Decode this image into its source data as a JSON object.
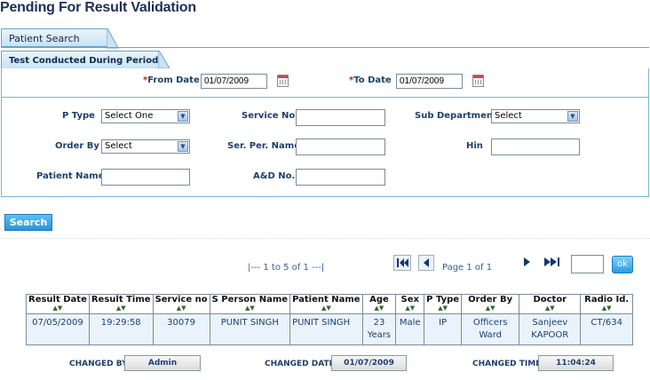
{
  "page": {
    "title": "Pending For Result Validation"
  },
  "tabs": {
    "patient_search": "Patient Search",
    "period": "Test Conducted During Period"
  },
  "period": {
    "from_label": "From Date",
    "from_value": "01/07/2009",
    "to_label": "To Date",
    "to_value": "01/07/2009",
    "required_mark": "*"
  },
  "filters": {
    "p_type": {
      "label": "P Type",
      "value": "Select One"
    },
    "service_no": {
      "label": "Service No.",
      "value": ""
    },
    "sub_department": {
      "label": "Sub Department",
      "value": "Select"
    },
    "order_by": {
      "label": "Order By",
      "value": "Select"
    },
    "ser_per_name": {
      "label": "Ser. Per. Name",
      "value": ""
    },
    "hin": {
      "label": "Hin",
      "value": ""
    },
    "patient_name": {
      "label": "Patient Name",
      "value": ""
    },
    "ad_no": {
      "label": "A&D No.",
      "value": ""
    }
  },
  "actions": {
    "search": "Search",
    "ok": "ok"
  },
  "pager": {
    "range_text": "|--- 1    to    5    of    1 ---|",
    "page_text": "Page 1 of 1",
    "page_input": ""
  },
  "table": {
    "headers": [
      "Result Date",
      "Result Time",
      "Service no",
      "S Person Name",
      "Patient Name",
      "Age",
      "Sex",
      "P Type",
      "Order By",
      "Doctor",
      "Radio Id."
    ],
    "rows": [
      {
        "result_date": "07/05/2009",
        "result_time": "19:29:58",
        "service_no": "30079",
        "s_person_name": "PUNIT SINGH",
        "patient_name": "PUNIT SINGH",
        "age_line1": "23",
        "age_line2": "Years",
        "sex": "Male",
        "p_type": "IP",
        "order_by_line1": "Officers",
        "order_by_line2": "Ward",
        "doctor_line1": "Sanjeev",
        "doctor_line2": "KAPOOR",
        "radio_id": "CT/634"
      }
    ]
  },
  "footer": {
    "changed_by_label": "CHANGED BY",
    "changed_by_value": "Admin",
    "changed_date_label": "CHANGED DATE",
    "changed_date_value": "01/07/2009",
    "changed_time_label": "CHANGED TIME",
    "changed_time_value": "11:04:24"
  },
  "icons": {
    "calendar": "calendar-icon",
    "first": "first-page-icon",
    "prev": "prev-page-icon",
    "next": "next-page-icon",
    "last": "last-page-icon",
    "sort": "sort-arrows-icon",
    "dropdown": "chevron-down-icon"
  }
}
